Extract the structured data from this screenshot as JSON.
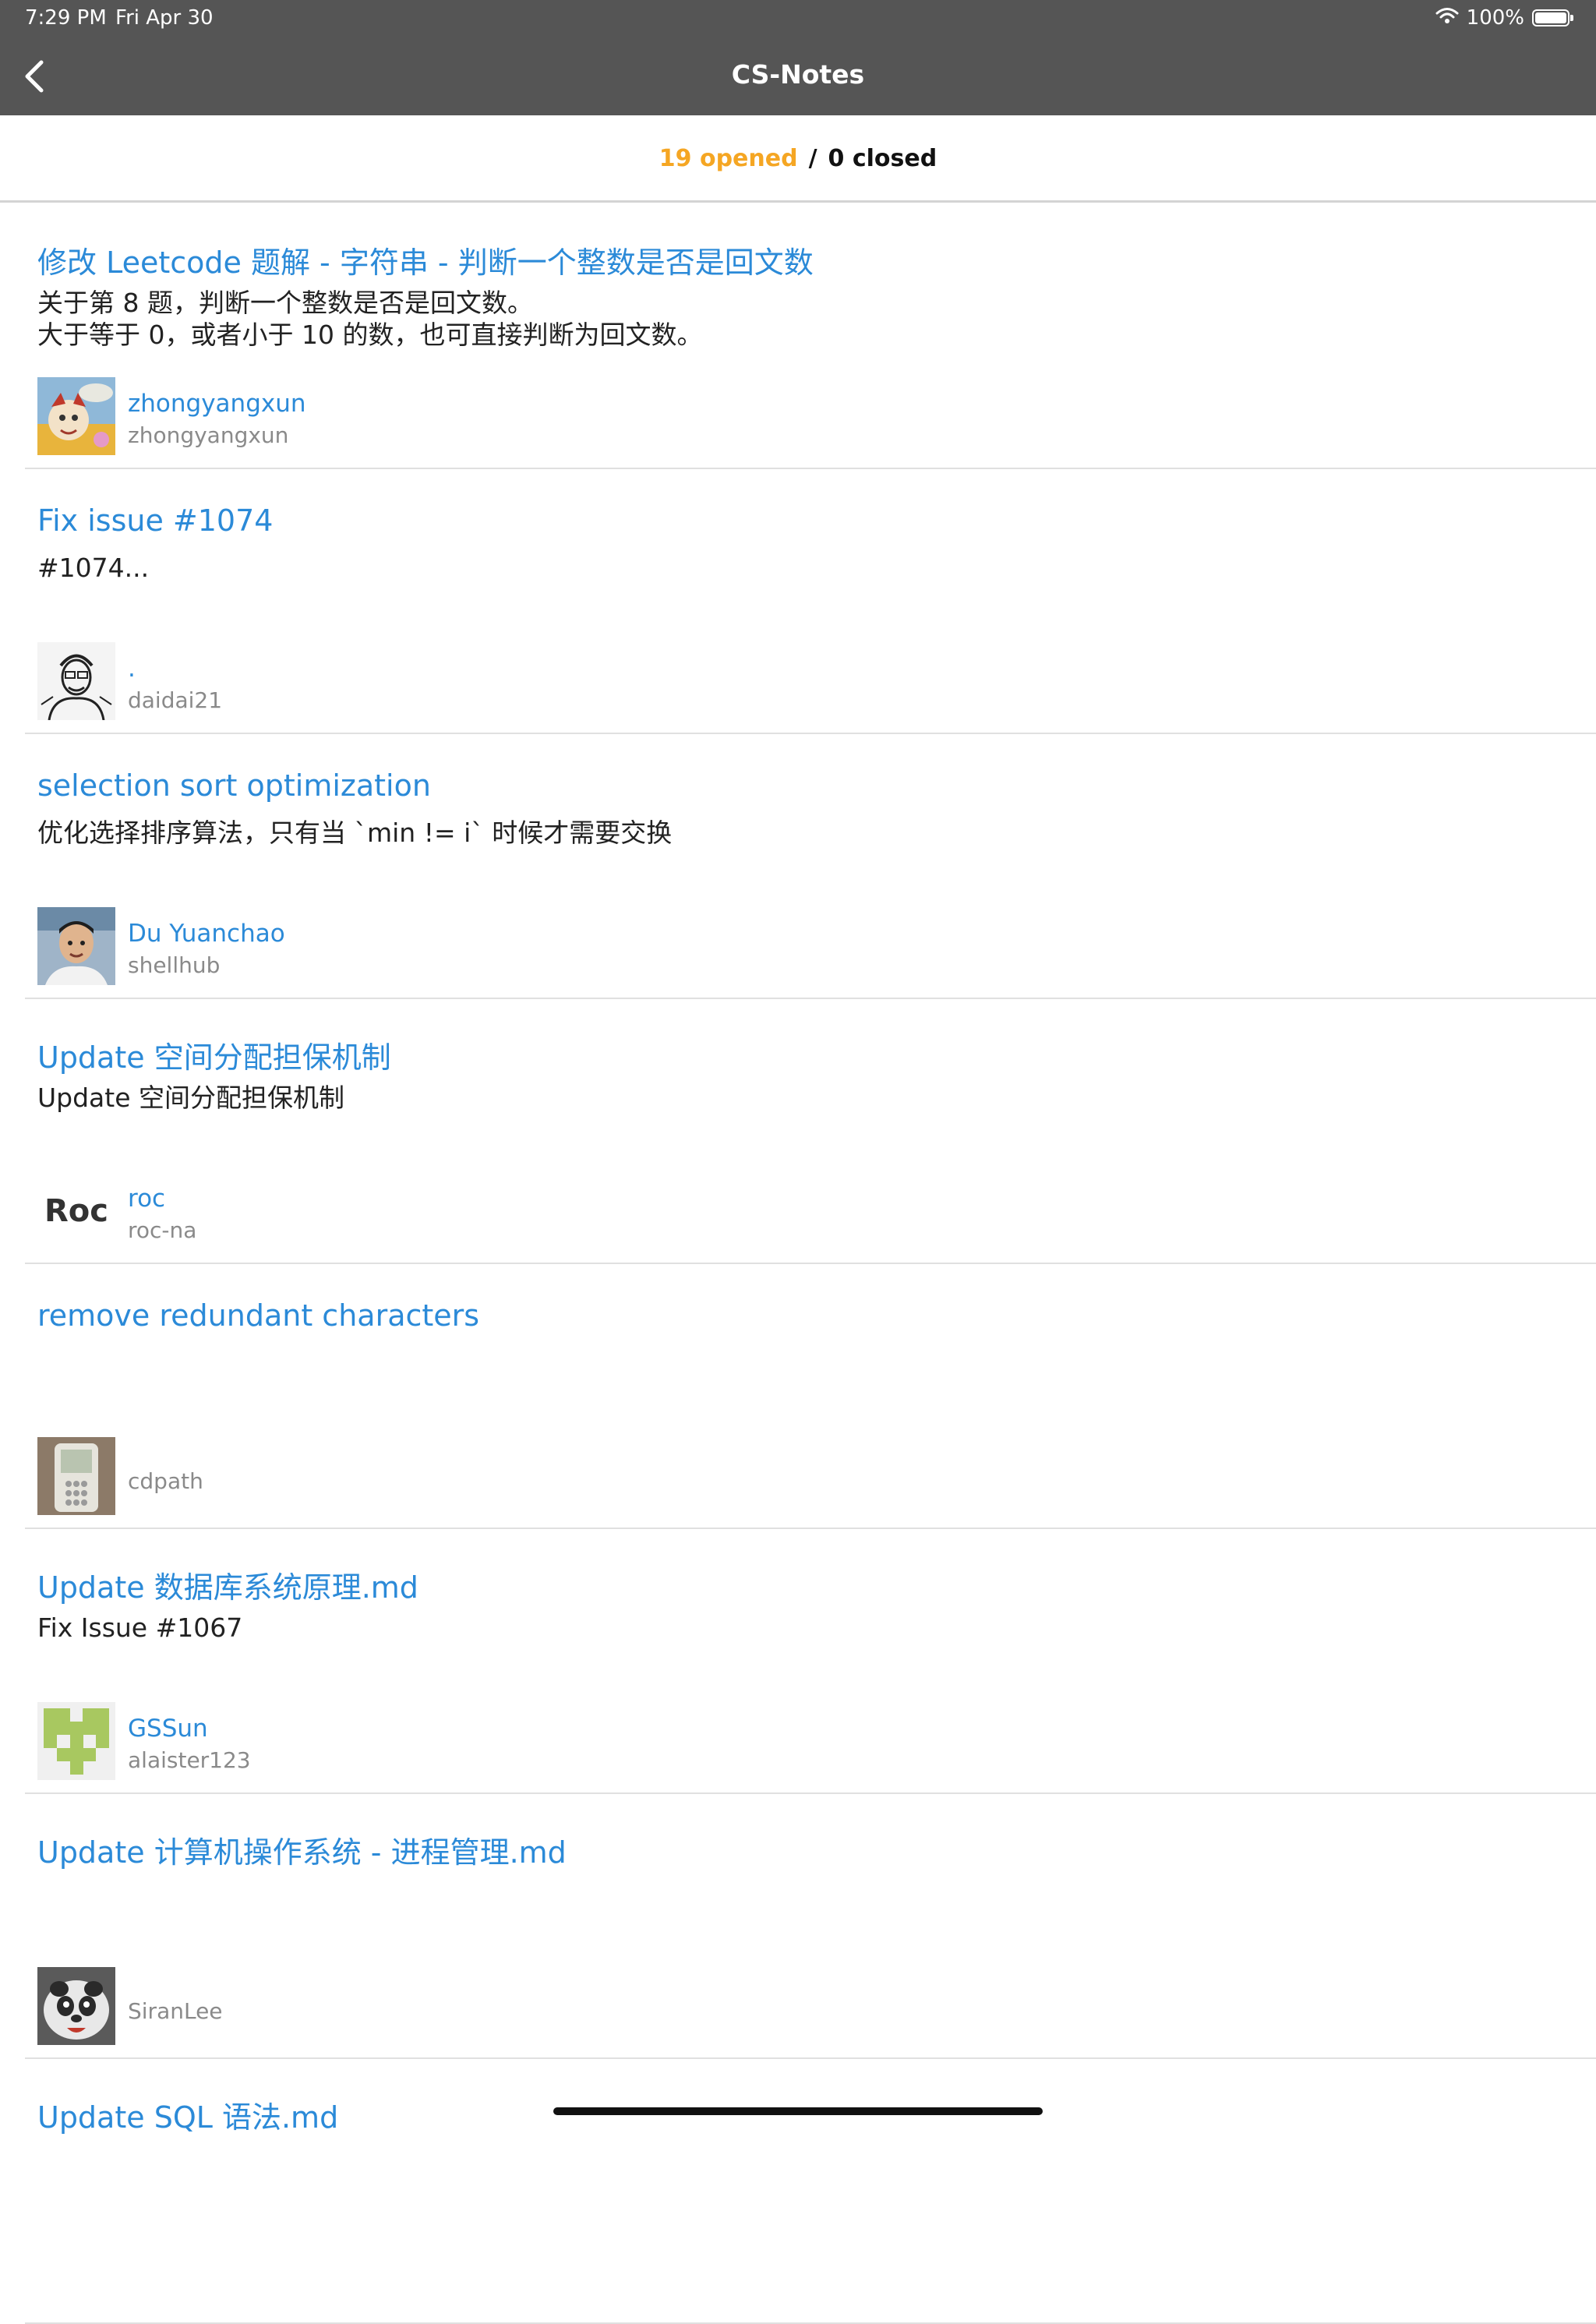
{
  "status_bar": {
    "time": "7:29 PM",
    "date": "Fri Apr 30",
    "battery_text": "100%",
    "wifi_icon": "wifi-icon",
    "battery_icon": "battery-icon"
  },
  "nav": {
    "title": "CS-Notes",
    "back_icon": "chevron-left-icon"
  },
  "segment": {
    "opened": "19 opened",
    "separator": "/",
    "closed": "0 closed",
    "active_color": "#f5a623"
  },
  "colors": {
    "link": "#2b8ad8",
    "bar": "#555555"
  },
  "pull_requests": [
    {
      "title": "修改 Leetcode 题解 - 字符串 - 判断一个整数是否是回文数",
      "body": "关于第 8 题，判断一个整数是否是回文数。\n大于等于 0，或者小于 10 的数，也可直接判断为回文数。",
      "author_name": "zhongyangxun",
      "author_login": "zhongyangxun",
      "avatar": "cartoon-avatar"
    },
    {
      "title": "Fix issue #1074",
      "body": "#1074...",
      "author_name": ".",
      "author_login": "daidai21",
      "avatar": "sketch-avatar"
    },
    {
      "title": "selection sort optimization",
      "body": "优化选择排序算法，只有当 `min != i` 时候才需要交换",
      "author_name": "Du Yuanchao",
      "author_login": "shellhub",
      "avatar": "photo-avatar"
    },
    {
      "title": "Update 空间分配担保机制",
      "body": "Update 空间分配担保机制",
      "author_name": "roc",
      "author_login": "roc-na",
      "avatar": "roc-logo-avatar",
      "avatar_text": "Roc"
    },
    {
      "title": "remove redundant characters",
      "body": "",
      "author_name": "",
      "author_login": "cdpath",
      "avatar": "phone-photo-avatar"
    },
    {
      "title": "Update 数据库系统原理.md",
      "body": "Fix Issue #1067",
      "author_name": "GSSun",
      "author_login": "alaister123",
      "avatar": "identicon-avatar"
    },
    {
      "title": "Update 计算机操作系统 - 进程管理.md",
      "body": "",
      "author_name": "",
      "author_login": "SiranLee",
      "avatar": "panda-avatar"
    },
    {
      "title": "Update SQL 语法.md",
      "body": "",
      "author_name": "",
      "author_login": "",
      "avatar": ""
    }
  ]
}
